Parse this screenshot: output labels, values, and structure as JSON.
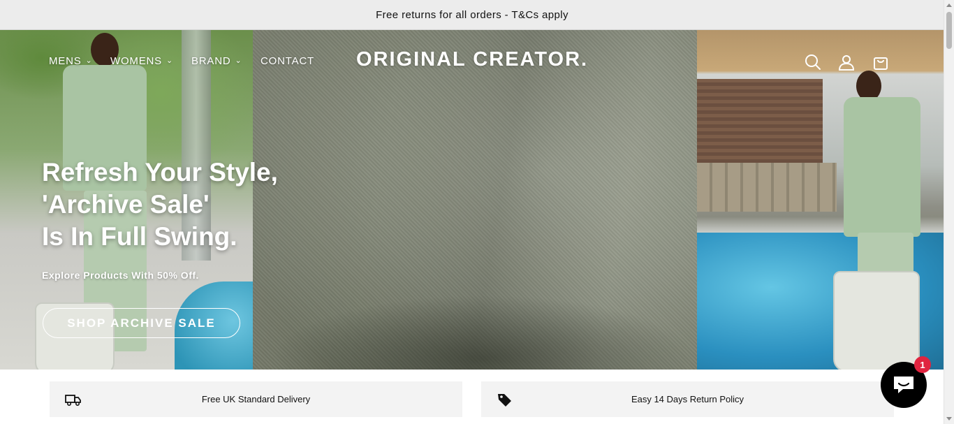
{
  "announcement": {
    "text": "Free returns for all orders - T&Cs apply"
  },
  "nav": {
    "items": [
      {
        "label": "MENS",
        "has_dropdown": true
      },
      {
        "label": "WOMENS",
        "has_dropdown": true
      },
      {
        "label": "BRAND",
        "has_dropdown": true
      },
      {
        "label": "CONTACT",
        "has_dropdown": false
      }
    ],
    "chevron": "⌄"
  },
  "brand": {
    "logo_text": "ORIGINAL CREATOR."
  },
  "header_icons": [
    "search-icon",
    "account-icon",
    "cart-icon"
  ],
  "hero": {
    "headline_lines": [
      "Refresh Your Style,",
      "'Archive Sale'",
      "Is In Full Swing."
    ],
    "subtext": "Explore Products With 50% Off.",
    "cta_label": "SHOP ARCHIVE SALE"
  },
  "features": [
    {
      "icon": "delivery-truck-icon",
      "label": "Free UK Standard Delivery"
    },
    {
      "icon": "price-tag-icon",
      "label": "Easy 14 Days Return Policy"
    }
  ],
  "chat": {
    "icon": "chat-bubble-icon",
    "badge_count": "1"
  },
  "colors": {
    "chat_badge": "#e0243f",
    "feature_bg": "#f3f3f3",
    "announcement_bg": "#ececec"
  }
}
